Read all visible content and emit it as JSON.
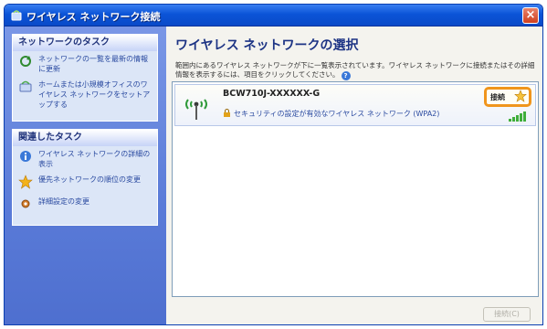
{
  "window": {
    "title": "ワイヤレス ネットワーク接続",
    "close_glyph": "×"
  },
  "sidebar": {
    "network_tasks": {
      "title": "ネットワークのタスク",
      "items": [
        {
          "label": "ネットワークの一覧を最新の情報に更新",
          "icon": "refresh-icon"
        },
        {
          "label": "ホームまたは小規模オフィスのワイヤレス ネットワークをセットアップする",
          "icon": "wizard-icon"
        }
      ]
    },
    "related_tasks": {
      "title": "関連したタスク",
      "items": [
        {
          "label": "ワイヤレス ネットワークの詳細の表示",
          "icon": "info-icon"
        },
        {
          "label": "優先ネットワークの順位の変更",
          "icon": "star-icon"
        },
        {
          "label": "詳細設定の変更",
          "icon": "settings-icon"
        }
      ]
    }
  },
  "main": {
    "heading": "ワイヤレス ネットワークの選択",
    "description": "範囲内にあるワイヤレス ネットワークが下に一覧表示されています。ワイヤレス ネットワークに接続またはその詳細情報を表示するには、項目をクリックしてください。",
    "network": {
      "ssid": "BCW710J-XXXXXX-G",
      "security": "セキュリティの設定が有効なワイヤレス ネットワーク (WPA2)",
      "status": "接続",
      "signal_level": 1.0
    },
    "connect_button": "接続(C)"
  },
  "colors": {
    "accent": "#f0951c",
    "titlebar": "#0b54d8",
    "sidebar": "#5a7bd8"
  }
}
